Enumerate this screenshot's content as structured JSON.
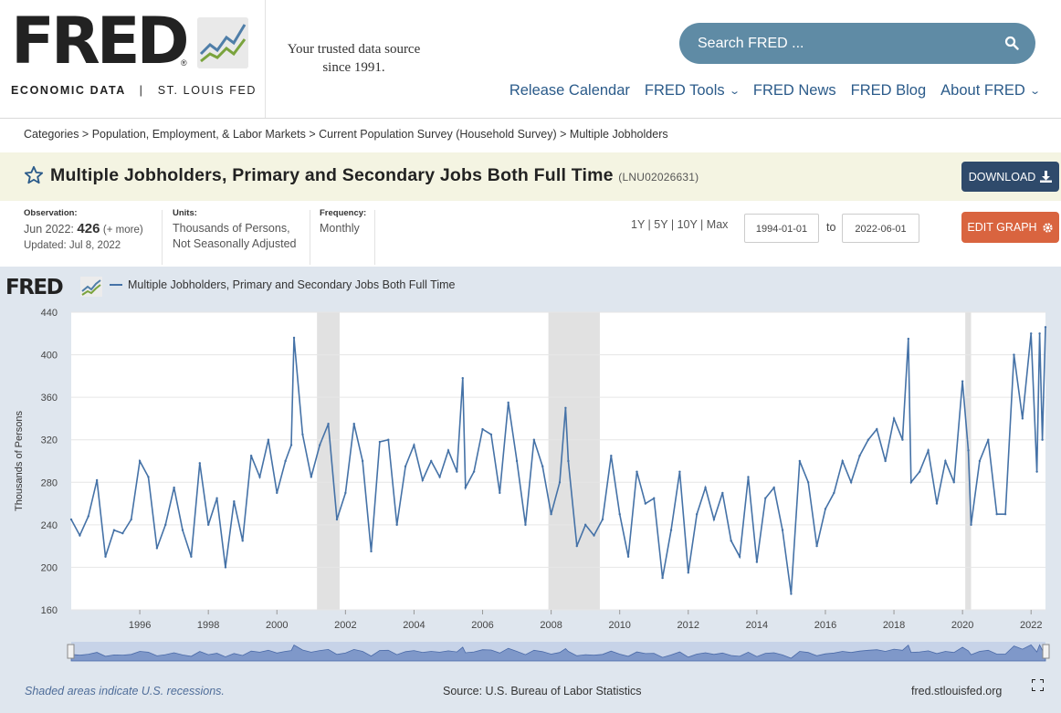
{
  "header": {
    "logo": "FRED",
    "logo_reg": "®",
    "logo_sub_left": "ECONOMIC DATA",
    "logo_sub_sep": "|",
    "logo_sub_right": "ST. LOUIS FED",
    "tagline_line1": "Your trusted data source",
    "tagline_line2": "since 1991.",
    "search_placeholder": "Search FRED ...",
    "nav": [
      {
        "label": "Release Calendar",
        "dropdown": false
      },
      {
        "label": "FRED Tools",
        "dropdown": true
      },
      {
        "label": "FRED News",
        "dropdown": false
      },
      {
        "label": "FRED Blog",
        "dropdown": false
      },
      {
        "label": "About FRED",
        "dropdown": true
      }
    ],
    "chevron": "⌄"
  },
  "breadcrumb": {
    "items": [
      "Categories",
      "Population, Employment, & Labor Markets",
      "Current Population Survey (Household Survey)",
      "Multiple Jobholders"
    ],
    "sep": " > "
  },
  "series": {
    "title": "Multiple Jobholders, Primary and Secondary Jobs Both Full Time",
    "id": "(LNU02026631)",
    "download_label": "DOWNLOAD",
    "observation_label": "Observation:",
    "observation_date": "Jun 2022:",
    "observation_value": "426",
    "observation_more": "(+ more)",
    "updated": "Updated: Jul 8, 2022",
    "units_label": "Units:",
    "units_line1": "Thousands of Persons,",
    "units_line2": "Not Seasonally Adjusted",
    "frequency_label": "Frequency:",
    "frequency": "Monthly",
    "ranges": [
      "1Y",
      "5Y",
      "10Y",
      "Max"
    ],
    "range_sep": " | ",
    "date_from": "1994-01-01",
    "to_label": "to",
    "date_to": "2022-06-01",
    "edit_label": "EDIT GRAPH"
  },
  "graph": {
    "logo": "FRED",
    "legend": "Multiple Jobholders, Primary and Secondary Jobs Both Full Time",
    "recession_note": "Shaded areas indicate U.S. recessions.",
    "source": "Source: U.S. Bureau of Labor Statistics",
    "url": "fred.stlouisfed.org"
  },
  "colors": {
    "line": "#4572a7",
    "recession": "#e1e1e1",
    "accent_download": "#2f4a6b",
    "accent_edit": "#d9643f",
    "search": "#5f8ba5"
  },
  "chart_data": {
    "type": "line",
    "ylabel": "Thousands of Persons",
    "ylim": [
      160,
      440
    ],
    "yticks": [
      160,
      200,
      240,
      280,
      320,
      360,
      400,
      440
    ],
    "xlim": [
      1994.0,
      2022.42
    ],
    "xticks": [
      1996,
      1998,
      2000,
      2002,
      2004,
      2006,
      2008,
      2010,
      2012,
      2014,
      2016,
      2018,
      2020,
      2022
    ],
    "grid": true,
    "legend_position": "top-left",
    "recessions": [
      [
        2001.17,
        2001.83
      ],
      [
        2007.92,
        2009.42
      ],
      [
        2020.08,
        2020.25
      ]
    ],
    "series": [
      {
        "name": "Multiple Jobholders, Primary and Secondary Jobs Both Full Time",
        "x": [
          1994.0,
          1994.25,
          1994.5,
          1994.75,
          1995.0,
          1995.25,
          1995.5,
          1995.75,
          1996.0,
          1996.25,
          1996.5,
          1996.75,
          1997.0,
          1997.25,
          1997.5,
          1997.75,
          1998.0,
          1998.25,
          1998.5,
          1998.75,
          1999.0,
          1999.25,
          1999.5,
          1999.75,
          2000.0,
          2000.25,
          2000.42,
          2000.5,
          2000.75,
          2001.0,
          2001.25,
          2001.5,
          2001.75,
          2002.0,
          2002.25,
          2002.5,
          2002.75,
          2003.0,
          2003.25,
          2003.5,
          2003.75,
          2004.0,
          2004.25,
          2004.5,
          2004.75,
          2005.0,
          2005.25,
          2005.42,
          2005.5,
          2005.75,
          2006.0,
          2006.25,
          2006.5,
          2006.75,
          2007.0,
          2007.25,
          2007.5,
          2007.75,
          2008.0,
          2008.25,
          2008.42,
          2008.5,
          2008.75,
          2009.0,
          2009.25,
          2009.5,
          2009.75,
          2010.0,
          2010.25,
          2010.5,
          2010.75,
          2011.0,
          2011.25,
          2011.5,
          2011.75,
          2012.0,
          2012.25,
          2012.5,
          2012.75,
          2013.0,
          2013.25,
          2013.5,
          2013.75,
          2014.0,
          2014.25,
          2014.5,
          2014.75,
          2015.0,
          2015.25,
          2015.5,
          2015.75,
          2016.0,
          2016.25,
          2016.5,
          2016.75,
          2017.0,
          2017.25,
          2017.5,
          2017.75,
          2018.0,
          2018.25,
          2018.42,
          2018.5,
          2018.75,
          2019.0,
          2019.25,
          2019.5,
          2019.75,
          2020.0,
          2020.17,
          2020.25,
          2020.5,
          2020.75,
          2021.0,
          2021.25,
          2021.5,
          2021.75,
          2022.0,
          2022.17,
          2022.25,
          2022.33,
          2022.42
        ],
        "values": [
          245,
          230,
          248,
          282,
          210,
          235,
          232,
          245,
          300,
          285,
          218,
          240,
          275,
          235,
          210,
          298,
          240,
          265,
          200,
          262,
          225,
          305,
          285,
          320,
          270,
          300,
          315,
          416,
          325,
          285,
          315,
          335,
          245,
          270,
          335,
          300,
          215,
          318,
          320,
          240,
          295,
          315,
          282,
          300,
          285,
          310,
          290,
          378,
          275,
          290,
          330,
          325,
          270,
          355,
          300,
          240,
          320,
          295,
          250,
          280,
          350,
          300,
          220,
          240,
          230,
          245,
          305,
          250,
          210,
          290,
          260,
          265,
          190,
          235,
          290,
          195,
          250,
          275,
          245,
          270,
          225,
          210,
          285,
          205,
          265,
          275,
          235,
          175,
          300,
          280,
          220,
          255,
          270,
          300,
          280,
          305,
          320,
          330,
          300,
          340,
          320,
          415,
          280,
          290,
          310,
          260,
          300,
          280,
          375,
          310,
          240,
          300,
          320,
          250,
          250,
          400,
          340,
          420,
          290,
          420,
          320,
          426
        ]
      }
    ]
  }
}
